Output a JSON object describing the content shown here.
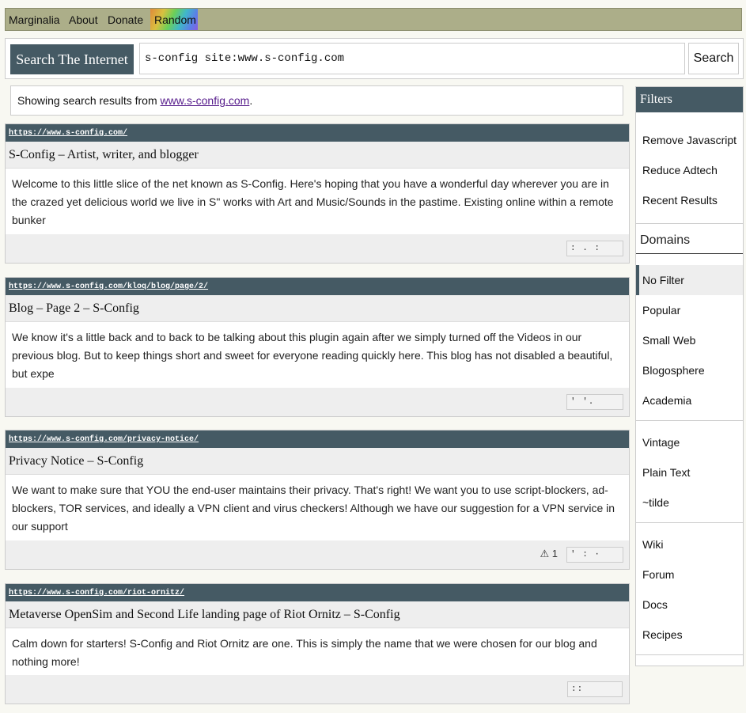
{
  "nav": {
    "items": [
      "Marginalia",
      "About",
      "Donate"
    ],
    "random": "Random"
  },
  "search": {
    "label": "Search The Internet",
    "value": "s-config site:www.s-config.com",
    "button": "Search"
  },
  "info": {
    "prefix": "Showing search results from ",
    "link": "www.s-config.com",
    "suffix": "."
  },
  "results": [
    {
      "url": "https://www.s-config.com/",
      "title": "S-Config – Artist, writer, and blogger",
      "desc": "Welcome to this little slice of the net known as S-Config. Here's hoping that you have a wonderful day wherever you are in the crazed yet delicious world we live in S\" works with Art and Music/Sounds in the pastime. Existing online within a remote bunker",
      "dots": ": . :"
    },
    {
      "url": "https://www.s-config.com/kloq/blog/page/2/",
      "title": "Blog – Page 2 – S-Config",
      "desc": "We know it's a little back and to back to be talking about this plugin again after we simply turned off the Videos in our previous blog. But to keep things short and sweet for everyone reading quickly here. This blog has not disabled a beautiful, but expe",
      "dots": "'  '."
    },
    {
      "url": "https://www.s-config.com/privacy-notice/",
      "title": "Privacy Notice – S-Config",
      "desc": "We want to make sure that YOU the end-user maintains their privacy. That's right! We want you to use script-blockers, ad-blockers, TOR services, and ideally a VPN client and virus checkers! Although we have our suggestion for a VPN service in our support",
      "warning": "⚠ 1",
      "dots": "'  :   ·"
    },
    {
      "url": "https://www.s-config.com/riot-ornitz/",
      "title": "Metaverse OpenSim and Second Life landing page of Riot Ornitz – S-Config",
      "desc": "Calm down for starters! S-Config and Riot Ornitz are one. This is simply the name that we were chosen for our blog and nothing more!",
      "dots": "::"
    }
  ],
  "filters": {
    "title": "Filters",
    "options": [
      "Remove Javascript",
      "Reduce Adtech",
      "Recent Results"
    ],
    "domains_label": "Domains",
    "domains": [
      "No Filter",
      "Popular",
      "Small Web",
      "Blogosphere",
      "Academia"
    ],
    "group2": [
      "Vintage",
      "Plain Text",
      "~tilde"
    ],
    "group3": [
      "Wiki",
      "Forum",
      "Docs",
      "Recipes"
    ],
    "selected": "No Filter"
  },
  "colors": {
    "topbar": "#acae89",
    "header": "#455a64",
    "link": "#551a8b"
  }
}
